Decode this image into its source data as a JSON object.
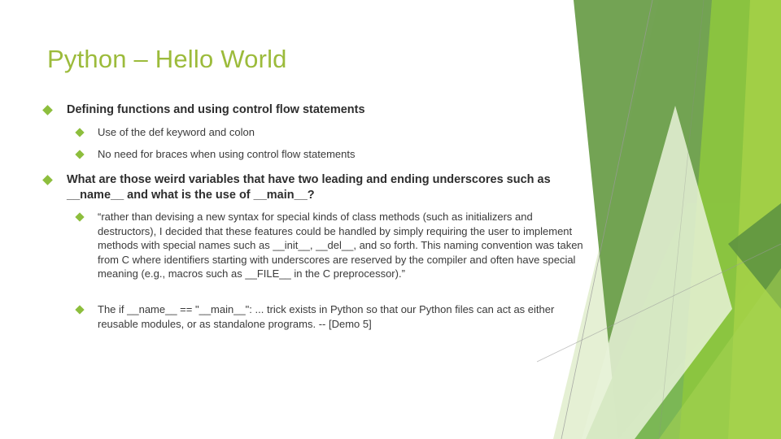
{
  "slide": {
    "title": "Python – Hello World",
    "theme_colors": {
      "title": "#9CBB3B",
      "bullet": "#8DBE3D",
      "body_text": "#3a3a3a",
      "decor_dark_green": "#6B9E4B",
      "decor_mid_green": "#76B447",
      "decor_bright_green": "#8CC63F",
      "decor_light_green": "#A5D14B",
      "decor_pale_green": "#DDEAC3",
      "decor_line": "#9a9a9a"
    },
    "bullets": [
      {
        "level": 1,
        "name": "bullet-defining-functions",
        "text": "Defining functions and using control flow statements"
      },
      {
        "level": 2,
        "name": "bullet-def-keyword",
        "text": "Use of the def keyword and colon"
      },
      {
        "level": 2,
        "name": "bullet-no-braces",
        "text": "No need for braces when using control flow statements"
      },
      {
        "level": 1,
        "name": "bullet-weird-variables",
        "text": "What are those weird variables that have two leading and ending underscores such as __name__ and what is the use of __main__?"
      },
      {
        "level": 2,
        "name": "bullet-guido-quote",
        "text": "“rather than devising a new syntax for special kinds of class methods (such as initializers and destructors), I decided that these features could be handled by simply requiring the user to implement methods with special names such as __init__, __del__, and so forth. This naming convention was taken from C where identifiers starting with underscores are reserved by the compiler and often have special meaning (e.g., macros such as __FILE__ in the C preprocessor).”"
      },
      {
        "level": 2,
        "name": "bullet-main-trick",
        "text": "The if __name__ == \"__main__\": ... trick exists in Python so that our Python files can act as either reusable modules, or as standalone programs.  -- [Demo 5]"
      }
    ],
    "decoration": {
      "name": "facet-green-polygons",
      "description": "angular overlapping green polygon graphic on right edge"
    }
  }
}
